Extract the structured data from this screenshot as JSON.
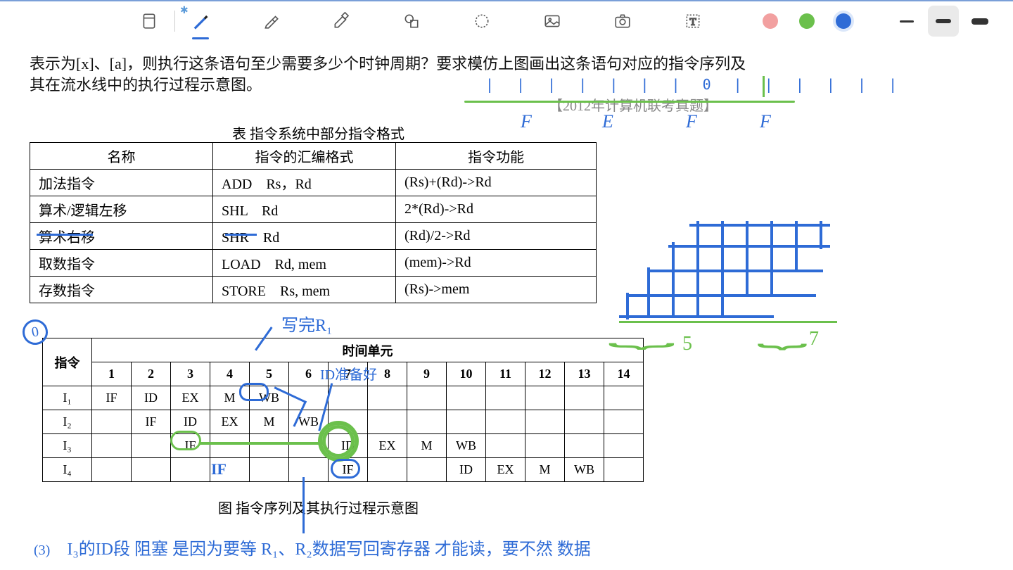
{
  "toolbar": {
    "tools": [
      "document",
      "pen",
      "highlighter",
      "marker",
      "shapes",
      "lasso",
      "image",
      "camera",
      "text"
    ],
    "colors": [
      "red",
      "green",
      "blue"
    ],
    "selected_tool": "pen",
    "selected_color": "blue"
  },
  "question": {
    "text": "表示为[x]、[a]，则执行这条语句至少需要多少个时钟周期？要求模仿上图画出这条语句对应的指令序列及其在流水线中的执行过程示意图。",
    "source": "【2012年计算机联考真题】"
  },
  "table1": {
    "title": "表   指令系统中部分指令格式",
    "headers": [
      "名称",
      "指令的汇编格式",
      "指令功能"
    ],
    "rows": [
      [
        "加法指令",
        "ADD　Rs，Rd",
        "(Rs)+(Rd)->Rd"
      ],
      [
        "算术/逻辑左移",
        "SHL　Rd",
        "2*(Rd)->Rd"
      ],
      [
        "算术右移",
        "SHR　Rd",
        "(Rd)/2->Rd"
      ],
      [
        "取数指令",
        "LOAD　Rd, mem",
        "(mem)->Rd"
      ],
      [
        "存数指令",
        "STORE　Rs, mem",
        "(Rs)->mem"
      ]
    ]
  },
  "table2": {
    "top_header": "时间单元",
    "col0": "指令",
    "cols": [
      "1",
      "2",
      "3",
      "4",
      "5",
      "6",
      "7",
      "8",
      "9",
      "10",
      "11",
      "12",
      "13",
      "14"
    ],
    "rows": [
      {
        "label": "I₁",
        "cells": [
          "IF",
          "ID",
          "EX",
          "M",
          "WB",
          "",
          "",
          "",
          "",
          "",
          "",
          "",
          "",
          ""
        ]
      },
      {
        "label": "I₂",
        "cells": [
          "",
          "IF",
          "ID",
          "EX",
          "M",
          "WB",
          "",
          "",
          "",
          "",
          "",
          "",
          "",
          ""
        ]
      },
      {
        "label": "I₃",
        "cells": [
          "",
          "",
          "IF",
          "",
          "",
          "",
          "ID",
          "EX",
          "M",
          "WB",
          "",
          "",
          "",
          ""
        ]
      },
      {
        "label": "I₄",
        "cells": [
          "",
          "",
          "",
          "",
          "",
          "",
          "IF",
          "",
          "",
          "ID",
          "EX",
          "M",
          "WB",
          ""
        ]
      }
    ],
    "caption": "图  指令序列及其执行过程示意图"
  },
  "annotations": {
    "ticks": "| | |  | |  |  | 0   | | |   | | |",
    "fefe": [
      "F",
      "E",
      "F",
      "F"
    ],
    "write_r1": "写完R₁",
    "id_ready": "ID准备好",
    "hw_if": "IF",
    "bottom_num": "(3)",
    "bottom_text": "I₃的ID段 阻塞 是因为要等 R₁、R₂数据写回寄存器 才能读，要不然 数据",
    "sketch_5": "5",
    "sketch_7": "7"
  }
}
